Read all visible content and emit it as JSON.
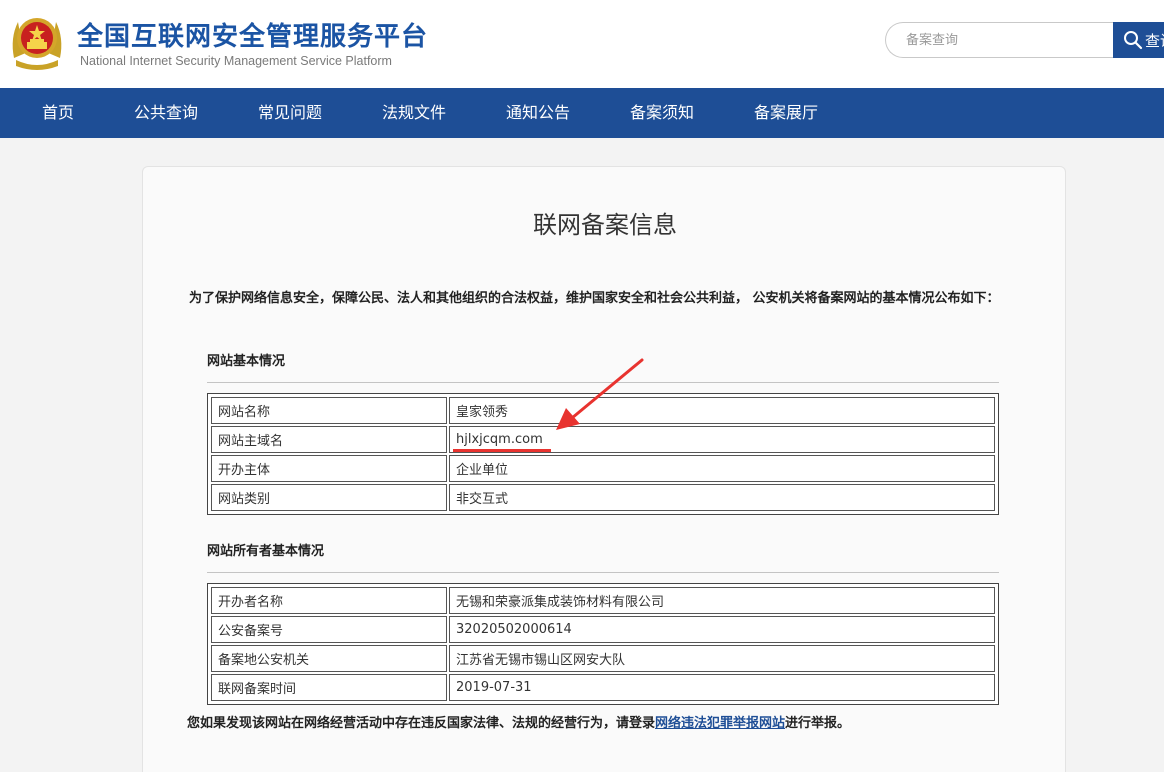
{
  "header": {
    "title": "全国互联网安全管理服务平台",
    "subtitle": "National Internet Security Management Service Platform",
    "search_placeholder": "备案查询",
    "search_button_label": "查询"
  },
  "nav": {
    "items": [
      "首页",
      "公共查询",
      "常见问题",
      "法规文件",
      "通知公告",
      "备案须知",
      "备案展厅"
    ]
  },
  "content": {
    "title": "联网备案信息",
    "intro": "为了保护网络信息安全，保障公民、法人和其他组织的合法权益，维护国家安全和社会公共利益， 公安机关将备案网站的基本情况公布如下：",
    "site_section": {
      "title": "网站基本情况",
      "rows": [
        {
          "label": "网站名称",
          "value": "皇家领秀"
        },
        {
          "label": "网站主域名",
          "value": "hjlxjcqm.com"
        },
        {
          "label": "开办主体",
          "value": "企业单位"
        },
        {
          "label": "网站类别",
          "value": "非交互式"
        }
      ]
    },
    "owner_section": {
      "title": "网站所有者基本情况",
      "rows": [
        {
          "label": "开办者名称",
          "value": "无锡和荣豪派集成装饰材料有限公司"
        },
        {
          "label": "公安备案号",
          "value": "32020502000614"
        },
        {
          "label": "备案地公安机关",
          "value": "江苏省无锡市锡山区网安大队"
        },
        {
          "label": "联网备案时间",
          "value": "2019-07-31"
        }
      ]
    },
    "footer": {
      "text_before": "您如果发现该网站在网络经营活动中存在违反国家法律、法规的经营行为，请登录",
      "link_text": "网络违法犯罪举报网站",
      "text_after": "进行举报。"
    }
  },
  "colors": {
    "brand_blue": "#1e4e96",
    "title_blue": "#1b54a4",
    "annotation_red": "#e8332f"
  }
}
